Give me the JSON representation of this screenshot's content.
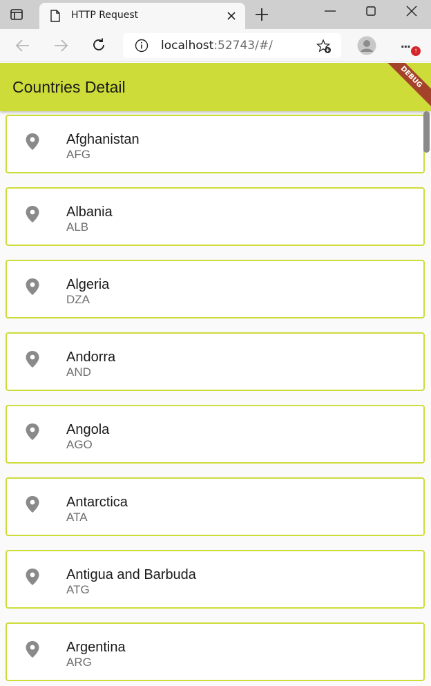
{
  "browser": {
    "tab_title": "HTTP Request",
    "url_host": "localhost",
    "url_rest": ":52743/#/",
    "menu_dots": "...",
    "update_badge": "↑"
  },
  "app": {
    "title": "Countries Detail",
    "debug_label": "DEBUG",
    "accent_color": "#cddc39",
    "pin_icon": "location-pin-icon"
  },
  "countries": [
    {
      "name": "Afghanistan",
      "code": "AFG"
    },
    {
      "name": "Albania",
      "code": "ALB"
    },
    {
      "name": "Algeria",
      "code": "DZA"
    },
    {
      "name": "Andorra",
      "code": "AND"
    },
    {
      "name": "Angola",
      "code": "AGO"
    },
    {
      "name": "Antarctica",
      "code": "ATA"
    },
    {
      "name": "Antigua and Barbuda",
      "code": "ATG"
    },
    {
      "name": "Argentina",
      "code": "ARG"
    }
  ]
}
